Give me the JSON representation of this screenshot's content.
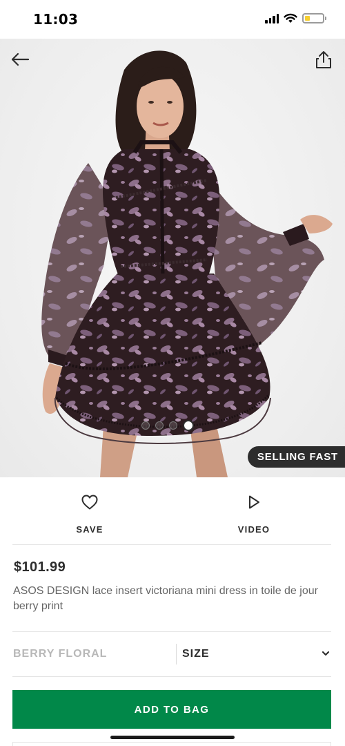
{
  "status_bar": {
    "time": "11:03"
  },
  "hero": {
    "badge": "SELLING FAST",
    "carousel": {
      "count": 4,
      "active_index": 3
    }
  },
  "actions": {
    "save_label": "SAVE",
    "video_label": "VIDEO"
  },
  "product": {
    "price": "$101.99",
    "title": "ASOS DESIGN lace insert victoriana mini dress in toile de jour berry print",
    "colour": "BERRY FLORAL",
    "size_label": "SIZE"
  },
  "cta": {
    "add_to_bag": "ADD TO BAG"
  },
  "colors": {
    "accent_green": "#018849",
    "text_dark": "#2d2d2d",
    "badge_bg": "#2d2d2d",
    "battery_fill": "#f6cf31"
  }
}
